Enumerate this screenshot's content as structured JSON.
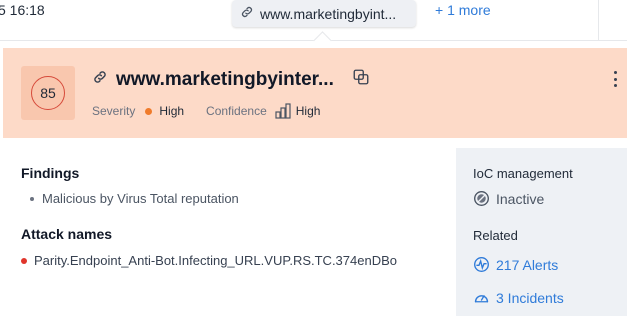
{
  "topbar": {
    "time": "5 16:18",
    "url_chip": "www.marketingbyint...",
    "more_link": "+ 1 more"
  },
  "header": {
    "score": "85",
    "title": "www.marketingbyinter...",
    "severity_label": "Severity",
    "severity_value": "High",
    "confidence_label": "Confidence",
    "confidence_value": "High",
    "colors": {
      "header_bg": "#fddac8",
      "severity_dot": "#f07b2b",
      "score_ring": "#d64a3a"
    }
  },
  "findings": {
    "title": "Findings",
    "items": [
      "Malicious by Virus Total reputation"
    ]
  },
  "attack_names": {
    "title": "Attack names",
    "items": [
      "Parity.Endpoint_Anti-Bot.Infecting_URL.VUP.RS.TC.374enDBo"
    ]
  },
  "ioc": {
    "title": "IoC management",
    "status": "Inactive"
  },
  "related": {
    "title": "Related",
    "alerts": "217 Alerts",
    "incidents": "3 Incidents"
  },
  "icons": [
    "link-icon",
    "copy-icon",
    "more-vertical-icon",
    "confidence-bars-icon",
    "inactive-icon",
    "alerts-icon",
    "incidents-gauge-icon"
  ]
}
